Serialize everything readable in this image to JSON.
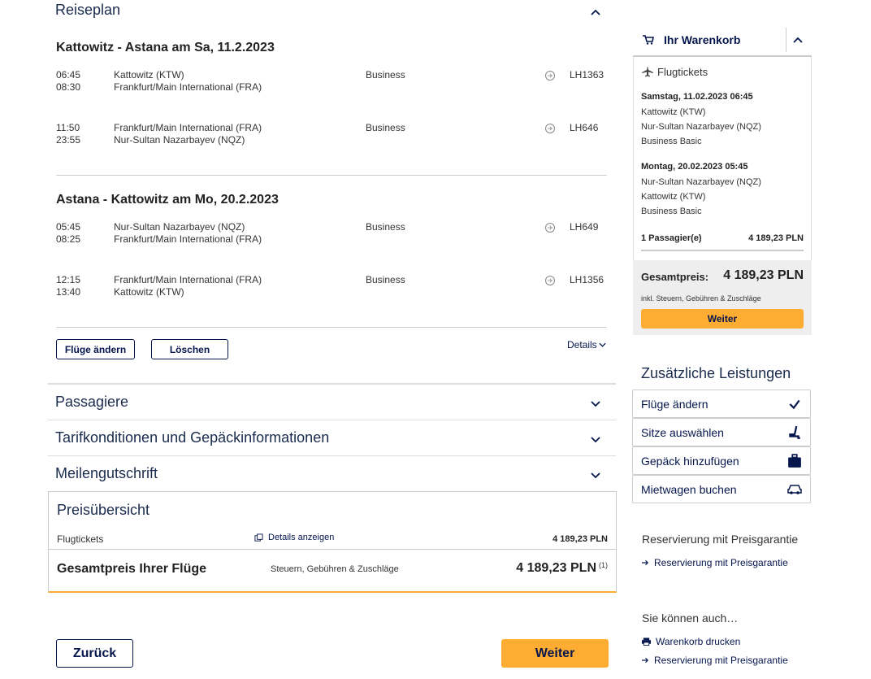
{
  "itinerary": {
    "title": "Reiseplan",
    "outbound": {
      "heading": "Kattowitz - Astana am Sa, 11.2.2023",
      "segments": [
        {
          "dep_time": "06:45",
          "arr_time": "08:30",
          "from": "Kattowitz (KTW)",
          "to": "Frankfurt/Main International (FRA)",
          "cabin": "Business",
          "flight": "LH1363"
        },
        {
          "dep_time": "11:50",
          "arr_time": "23:55",
          "from": "Frankfurt/Main International (FRA)",
          "to": "Nur-Sultan Nazarbayev (NQZ)",
          "cabin": "Business",
          "flight": "LH646"
        }
      ]
    },
    "inbound": {
      "heading": "Astana - Kattowitz am Mo, 20.2.2023",
      "segments": [
        {
          "dep_time": "05:45",
          "arr_time": "08:25",
          "from": "Nur-Sultan Nazarbayev (NQZ)",
          "to": "Frankfurt/Main International (FRA)",
          "cabin": "Business",
          "flight": "LH649"
        },
        {
          "dep_time": "12:15",
          "arr_time": "13:40",
          "from": "Frankfurt/Main International (FRA)",
          "to": "Kattowitz (KTW)",
          "cabin": "Business",
          "flight": "LH1356"
        }
      ]
    },
    "change_button": "Flüge ändern",
    "delete_button": "Löschen",
    "details_link": "Details"
  },
  "sections": {
    "passengers": "Passagiere",
    "fares": "Tarifkonditionen und Gepäckinformationen",
    "miles": "Meilengutschrift"
  },
  "price_overview": {
    "title": "Preisübersicht",
    "tickets_label": "Flugtickets",
    "details_link": "Details anzeigen",
    "tickets_amount": "4 189,23 PLN",
    "total_label": "Gesamtpreis Ihrer Flüge",
    "taxes_label": "Steuern, Gebühren & Zuschläge",
    "total_amount": "4 189,23 PLN",
    "footnote": "(1)"
  },
  "nav": {
    "back": "Zurück",
    "next": "Weiter"
  },
  "cart": {
    "title": "Ihr Warenkorb",
    "tickets_heading": "Flugtickets",
    "outbound": {
      "date": "Samstag, 11.02.2023 06:45",
      "from": "Kattowitz (KTW)",
      "to": "Nur-Sultan Nazarbayev (NQZ)",
      "fare": "Business Basic"
    },
    "inbound": {
      "date": "Montag, 20.02.2023 05:45",
      "from": "Nur-Sultan Nazarbayev (NQZ)",
      "to": "Kattowitz (KTW)",
      "fare": "Business Basic"
    },
    "passengers": "1 Passagier(e)",
    "passengers_amount": "4 189,23 PLN",
    "total_label": "Gesamtpreis:",
    "total_amount": "4 189,23 PLN",
    "total_note": "inkl. Steuern, Gebühren & Zuschläge",
    "next_button": "Weiter"
  },
  "services": {
    "title": "Zusätzliche Leistungen",
    "items": [
      {
        "label": "Flüge ändern",
        "icon": "check-icon"
      },
      {
        "label": "Sitze auswählen",
        "icon": "seat-icon"
      },
      {
        "label": "Gepäck hinzufügen",
        "icon": "luggage-icon"
      },
      {
        "label": "Mietwagen buchen",
        "icon": "car-icon"
      }
    ]
  },
  "price_guarantee": {
    "title": "Reservierung mit Preisgarantie",
    "link": "Reservierung mit Preisgarantie"
  },
  "also": {
    "title": "Sie können auch…",
    "print": "Warenkorb drucken",
    "guarantee": "Reservierung mit Preisgarantie"
  },
  "colors": {
    "navy": "#05164d",
    "yellow": "#ffad32",
    "border": "#cccccc"
  }
}
